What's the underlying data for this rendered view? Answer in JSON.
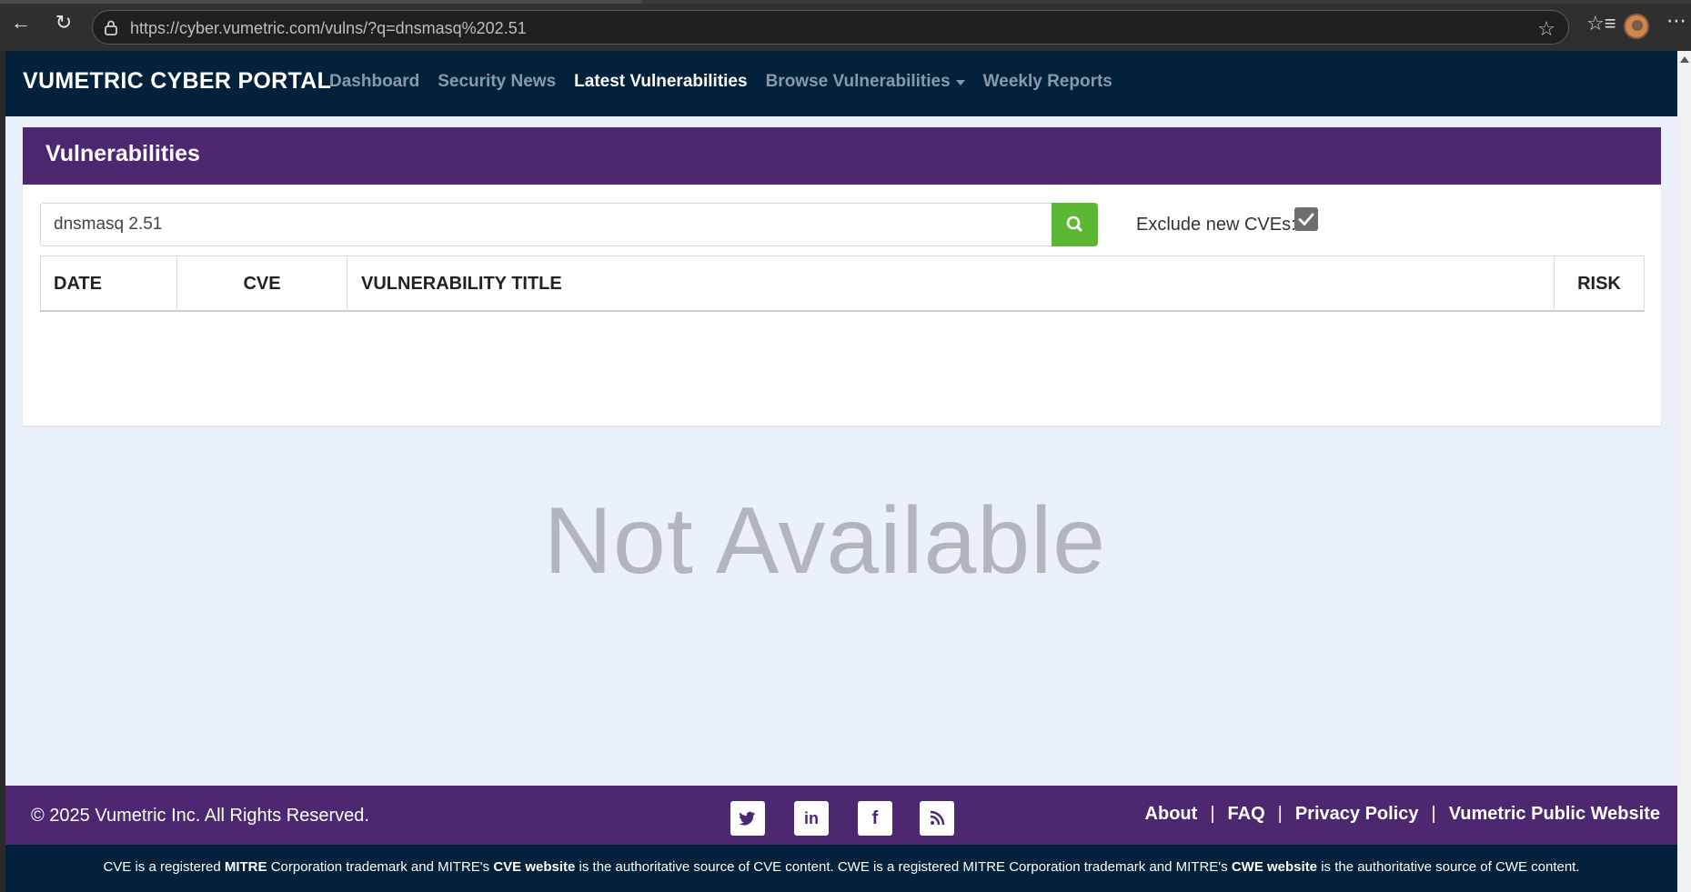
{
  "browser": {
    "url": "https://cyber.vumetric.com/vulns/?q=dnsmasq%202.51"
  },
  "navbar": {
    "brand": "VUMETRIC CYBER PORTAL",
    "links": [
      {
        "label": "Dashboard"
      },
      {
        "label": "Security News"
      },
      {
        "label": "Latest Vulnerabilities"
      },
      {
        "label": "Browse Vulnerabilities"
      },
      {
        "label": "Weekly Reports"
      }
    ]
  },
  "card": {
    "title": "Vulnerabilities",
    "search_value": "dnsmasq 2.51",
    "exclude_label": "Exclude new CVEs:",
    "exclude_checked": true,
    "columns": [
      "DATE",
      "CVE",
      "VULNERABILITY TITLE",
      "RISK"
    ]
  },
  "empty_state": "Not Available",
  "footer": {
    "copyright": "© 2025 Vumetric Inc. All Rights Reserved.",
    "social": [
      "twitter-icon",
      "linkedin-icon",
      "facebook-icon",
      "rss-icon"
    ],
    "links": [
      "About",
      "FAQ",
      "Privacy Policy",
      "Vumetric Public Website"
    ],
    "separator": "|",
    "disclaimer": {
      "part1": "CVE is a registered ",
      "mitre1": "MITRE",
      "part2": " Corporation trademark and MITRE's ",
      "cve_site": "CVE website",
      "part3": " is the authoritative source of CVE content. CWE is a registered MITRE Corporation trademark and MITRE's ",
      "cwe_site": "CWE website",
      "part4": " is the authoritative source of CWE content."
    }
  },
  "colors": {
    "navbar": "#02213a",
    "purple": "#4d2870",
    "search_green": "#5cb832",
    "page_bg": "#ebf1fa"
  }
}
